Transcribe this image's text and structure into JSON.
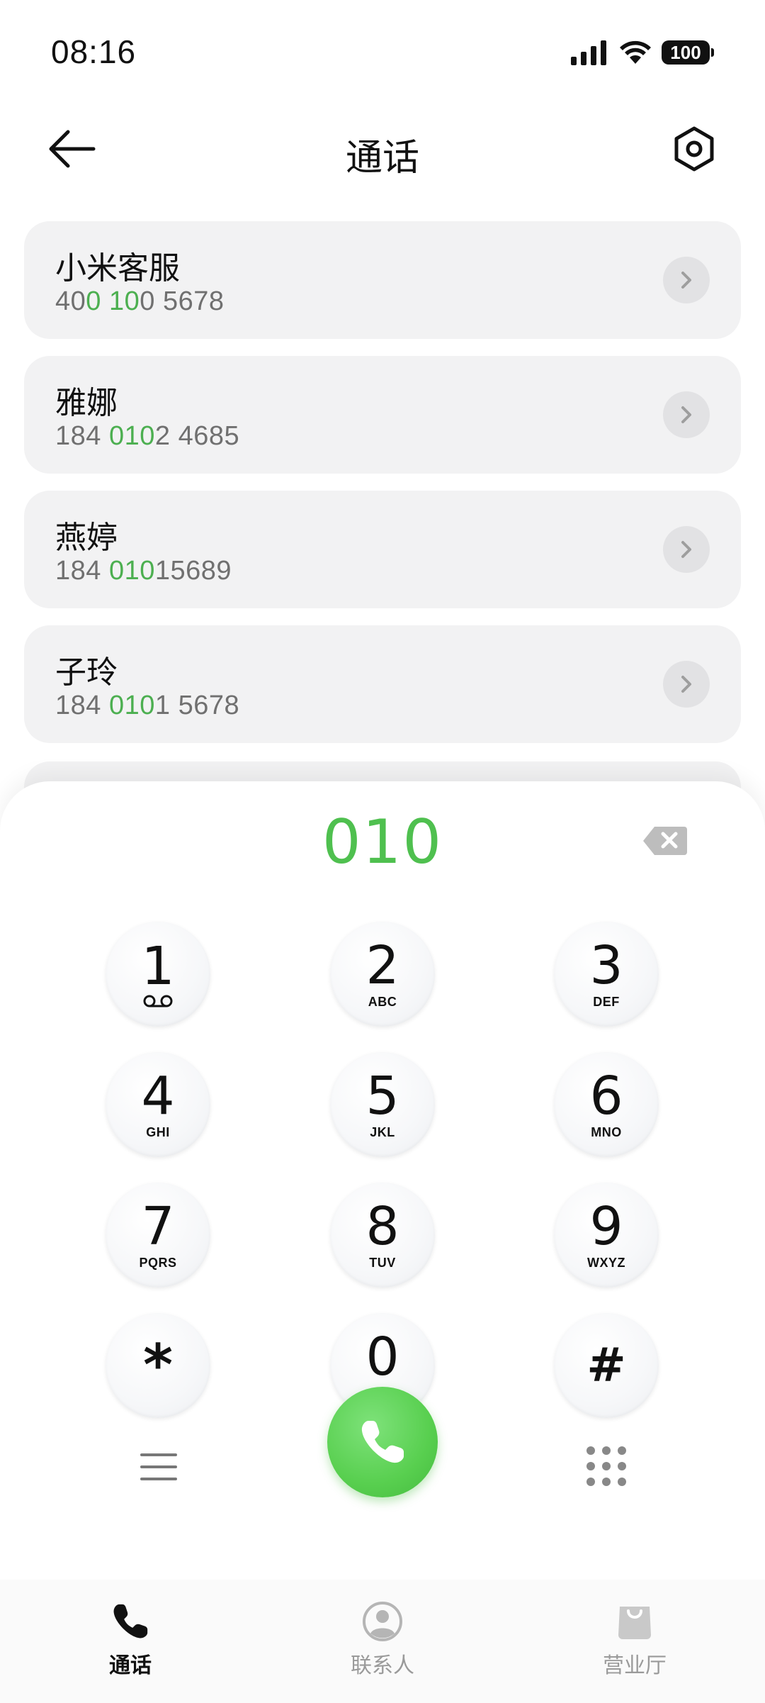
{
  "status_bar": {
    "time": "08:16",
    "battery": "100"
  },
  "header": {
    "title": "通话"
  },
  "contacts": [
    {
      "name": "小米客服",
      "number_parts": [
        [
          "40",
          ""
        ],
        [
          "0",
          "hl"
        ],
        [
          " ",
          ""
        ],
        [
          "10",
          "hl"
        ],
        [
          "0 5678",
          ""
        ]
      ]
    },
    {
      "name": "雅娜",
      "number_parts": [
        [
          "184 ",
          ""
        ],
        [
          "010",
          "hl"
        ],
        [
          "2 4685",
          ""
        ]
      ]
    },
    {
      "name": "燕婷",
      "number_parts": [
        [
          "184 ",
          ""
        ],
        [
          "010",
          "hl"
        ],
        [
          "15689",
          ""
        ]
      ]
    },
    {
      "name": "子玲",
      "number_parts": [
        [
          "184 ",
          ""
        ],
        [
          "010",
          "hl"
        ],
        [
          "1 5678",
          ""
        ]
      ]
    }
  ],
  "dialer": {
    "number": "010",
    "keys": [
      {
        "digit": "1",
        "letters": ""
      },
      {
        "digit": "2",
        "letters": "ABC"
      },
      {
        "digit": "3",
        "letters": "DEF"
      },
      {
        "digit": "4",
        "letters": "GHI"
      },
      {
        "digit": "5",
        "letters": "JKL"
      },
      {
        "digit": "6",
        "letters": "MNO"
      },
      {
        "digit": "7",
        "letters": "PQRS"
      },
      {
        "digit": "8",
        "letters": "TUV"
      },
      {
        "digit": "9",
        "letters": "WXYZ"
      },
      {
        "digit": "*",
        "letters": ""
      },
      {
        "digit": "0",
        "letters": "+"
      },
      {
        "digit": "#",
        "letters": ""
      }
    ]
  },
  "nav": {
    "calls": "通话",
    "contacts": "联系人",
    "store": "营业厅"
  },
  "colors": {
    "accent_green": "#4fc04f",
    "call_green": "#58cf4f"
  }
}
